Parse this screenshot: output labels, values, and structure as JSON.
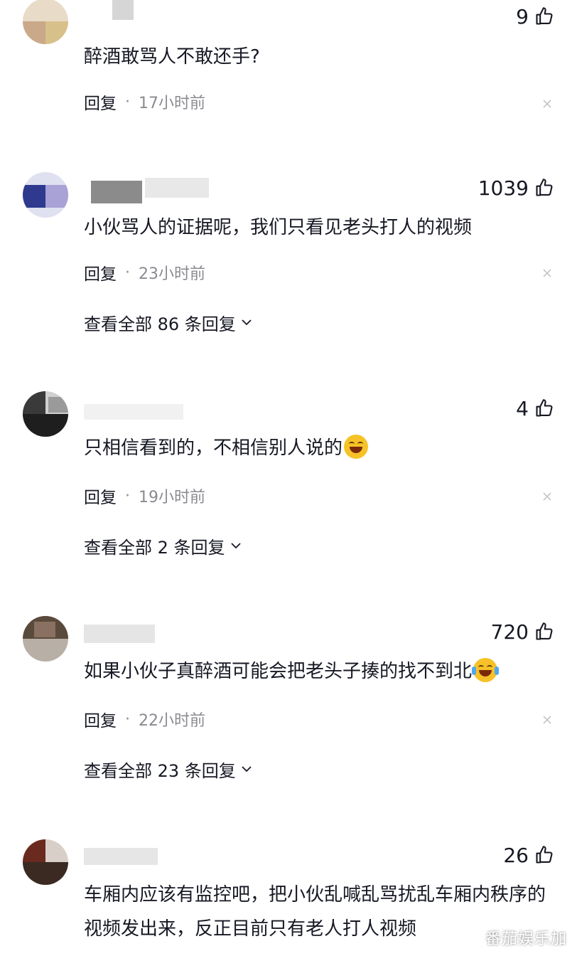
{
  "comments": [
    {
      "username": "",
      "likes": "9",
      "text": "醉酒敢骂人不敢还手?",
      "reply_label": "回复",
      "time": "17小时前",
      "view_replies": ""
    },
    {
      "username": "",
      "likes": "1039",
      "text": "小伙骂人的证据呢，我们只看见老头打人的视频",
      "reply_label": "回复",
      "time": "23小时前",
      "view_replies": "查看全部 86 条回复"
    },
    {
      "username": "",
      "likes": "4",
      "text": "只相信看到的，不相信别人说的",
      "reply_label": "回复",
      "time": "19小时前",
      "view_replies": "查看全部 2 条回复"
    },
    {
      "username": "",
      "likes": "720",
      "text": "如果小伙子真醉酒可能会把老头子揍的找不到北",
      "reply_label": "回复",
      "time": "22小时前",
      "view_replies": "查看全部 23 条回复"
    },
    {
      "username": "",
      "likes": "26",
      "text": "车厢内应该有监控吧，把小伙乱喊乱骂扰乱车厢内秩序的视频发出来，反正目前只有老人打人视频",
      "reply_label": "",
      "time": "",
      "view_replies": ""
    }
  ],
  "separator": "·",
  "watermark": "番茄娱乐加",
  "icons": {
    "like": "thumbs-up-icon",
    "close": "close-icon",
    "expand": "chevron-down-icon",
    "emoji_grin": "grinning-emoji-icon",
    "emoji_laugh_cry": "laughing-crying-emoji-icon"
  },
  "colors": {
    "text": "#161823",
    "meta": "#8a8b91",
    "emoji": "#f6c227"
  }
}
